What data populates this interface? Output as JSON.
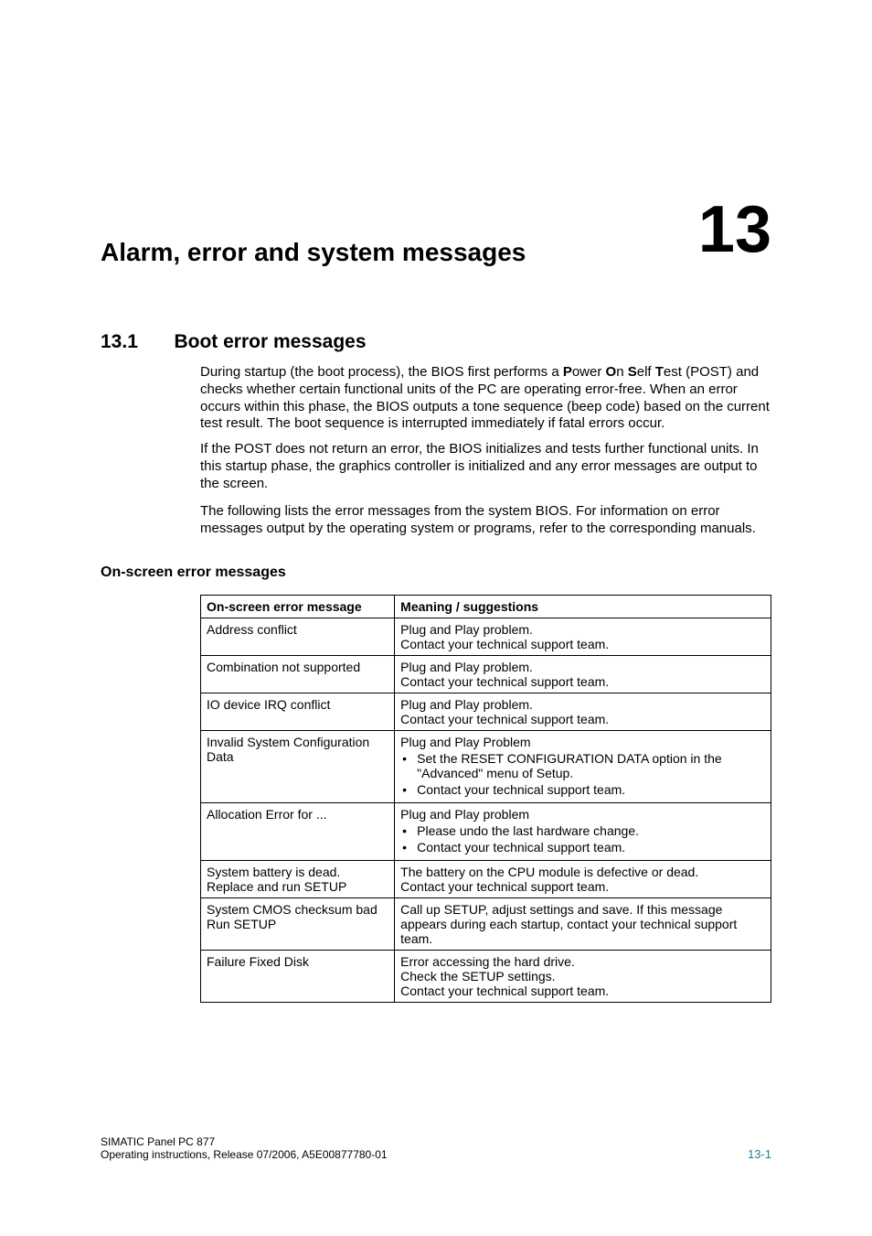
{
  "chapter": {
    "number": "13",
    "title": "Alarm, error and system messages"
  },
  "section": {
    "number": "13.1",
    "title": "Boot error messages"
  },
  "paragraphs": {
    "p1_pre": "During startup (the boot process), the BIOS first performs a ",
    "p1_b1": "P",
    "p1_m1": "ower ",
    "p1_b2": "O",
    "p1_m2": "n ",
    "p1_b3": "S",
    "p1_m3": "elf ",
    "p1_b4": "T",
    "p1_post": "est (POST) and checks whether certain functional units of the PC are operating error-free. When an error occurs within this phase, the BIOS outputs a tone sequence (beep code) based on the current test result. The boot sequence is interrupted immediately if fatal errors occur.",
    "p2": "If the POST does not return an error, the BIOS initializes and tests further functional units. In this startup phase, the graphics controller is initialized and any error messages are output to the screen.",
    "p3": "The following lists the error messages from the system BIOS. For information on error messages output by the operating system or programs, refer to the corresponding manuals."
  },
  "subheading": "On-screen error messages",
  "table": {
    "headers": [
      "On-screen error message",
      "Meaning / suggestions"
    ],
    "rows": [
      {
        "c1": "Address conflict",
        "c2_text": "Plug and Play problem.\nContact your technical support team.",
        "c2_items": []
      },
      {
        "c1": "Combination not supported",
        "c2_text": "Plug and Play problem.\nContact your technical support team.",
        "c2_items": []
      },
      {
        "c1": "IO device IRQ conflict",
        "c2_text": "Plug and Play problem.\nContact your technical support team.",
        "c2_items": []
      },
      {
        "c1": "Invalid System Configuration Data",
        "c2_text": "Plug and Play Problem",
        "c2_items": [
          "Set the RESET CONFIGURATION DATA option in the \"Advanced\" menu of Setup.",
          "Contact your technical support team."
        ]
      },
      {
        "c1": "Allocation Error for ...",
        "c2_text": "Plug and Play problem",
        "c2_items": [
          "Please undo the last hardware change.",
          "Contact your technical support team."
        ]
      },
      {
        "c1": "System battery is dead. Replace and run SETUP",
        "c2_text": "The battery on the CPU module is defective or dead.\nContact your technical support team.",
        "c2_items": []
      },
      {
        "c1": "System CMOS checksum bad Run SETUP",
        "c2_text": "Call up SETUP, adjust settings and save. If this message appears during each startup, contact your technical support team.",
        "c2_items": []
      },
      {
        "c1": " Failure Fixed Disk",
        "c2_text": "Error accessing the hard drive.\nCheck the SETUP settings.\nContact your technical support team.",
        "c2_items": []
      }
    ]
  },
  "footer": {
    "line1": "SIMATIC Panel PC 877",
    "line2": "Operating instructions, Release 07/2006, A5E00877780-01",
    "page": "13-1"
  }
}
